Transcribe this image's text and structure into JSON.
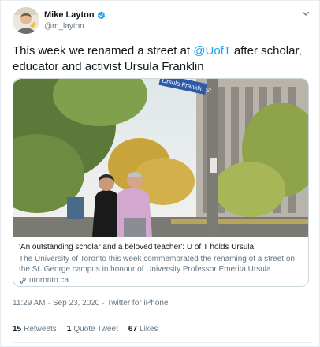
{
  "author": {
    "name": "Mike Layton",
    "handle": "@m_layton"
  },
  "tweet": {
    "text_before": "This week we renamed a street at ",
    "mention": "@UofT",
    "text_after": " after scholar, educator and activist Ursula Franklin"
  },
  "card": {
    "title": "'An outstanding scholar and a beloved teacher': U of T holds Ursula",
    "description": "The University of Toronto this week commemorated the renaming of a street on the St. George campus in honour of University Professor Emerita Ursula Franklin,...",
    "domain": "utoronto.ca",
    "street_sign_text": "Ursula Franklin St"
  },
  "meta": {
    "time": "11:29 AM",
    "separator": "·",
    "date": "Sep 23, 2020",
    "source": "Twitter for iPhone"
  },
  "stats": {
    "retweets_count": "15",
    "retweets_label": "Retweets",
    "quotes_count": "1",
    "quotes_label": "Quote Tweet",
    "likes_count": "67",
    "likes_label": "Likes"
  },
  "colors": {
    "accent": "#1da1f2",
    "secondary_text": "#657786",
    "primary_text": "#14171a"
  }
}
